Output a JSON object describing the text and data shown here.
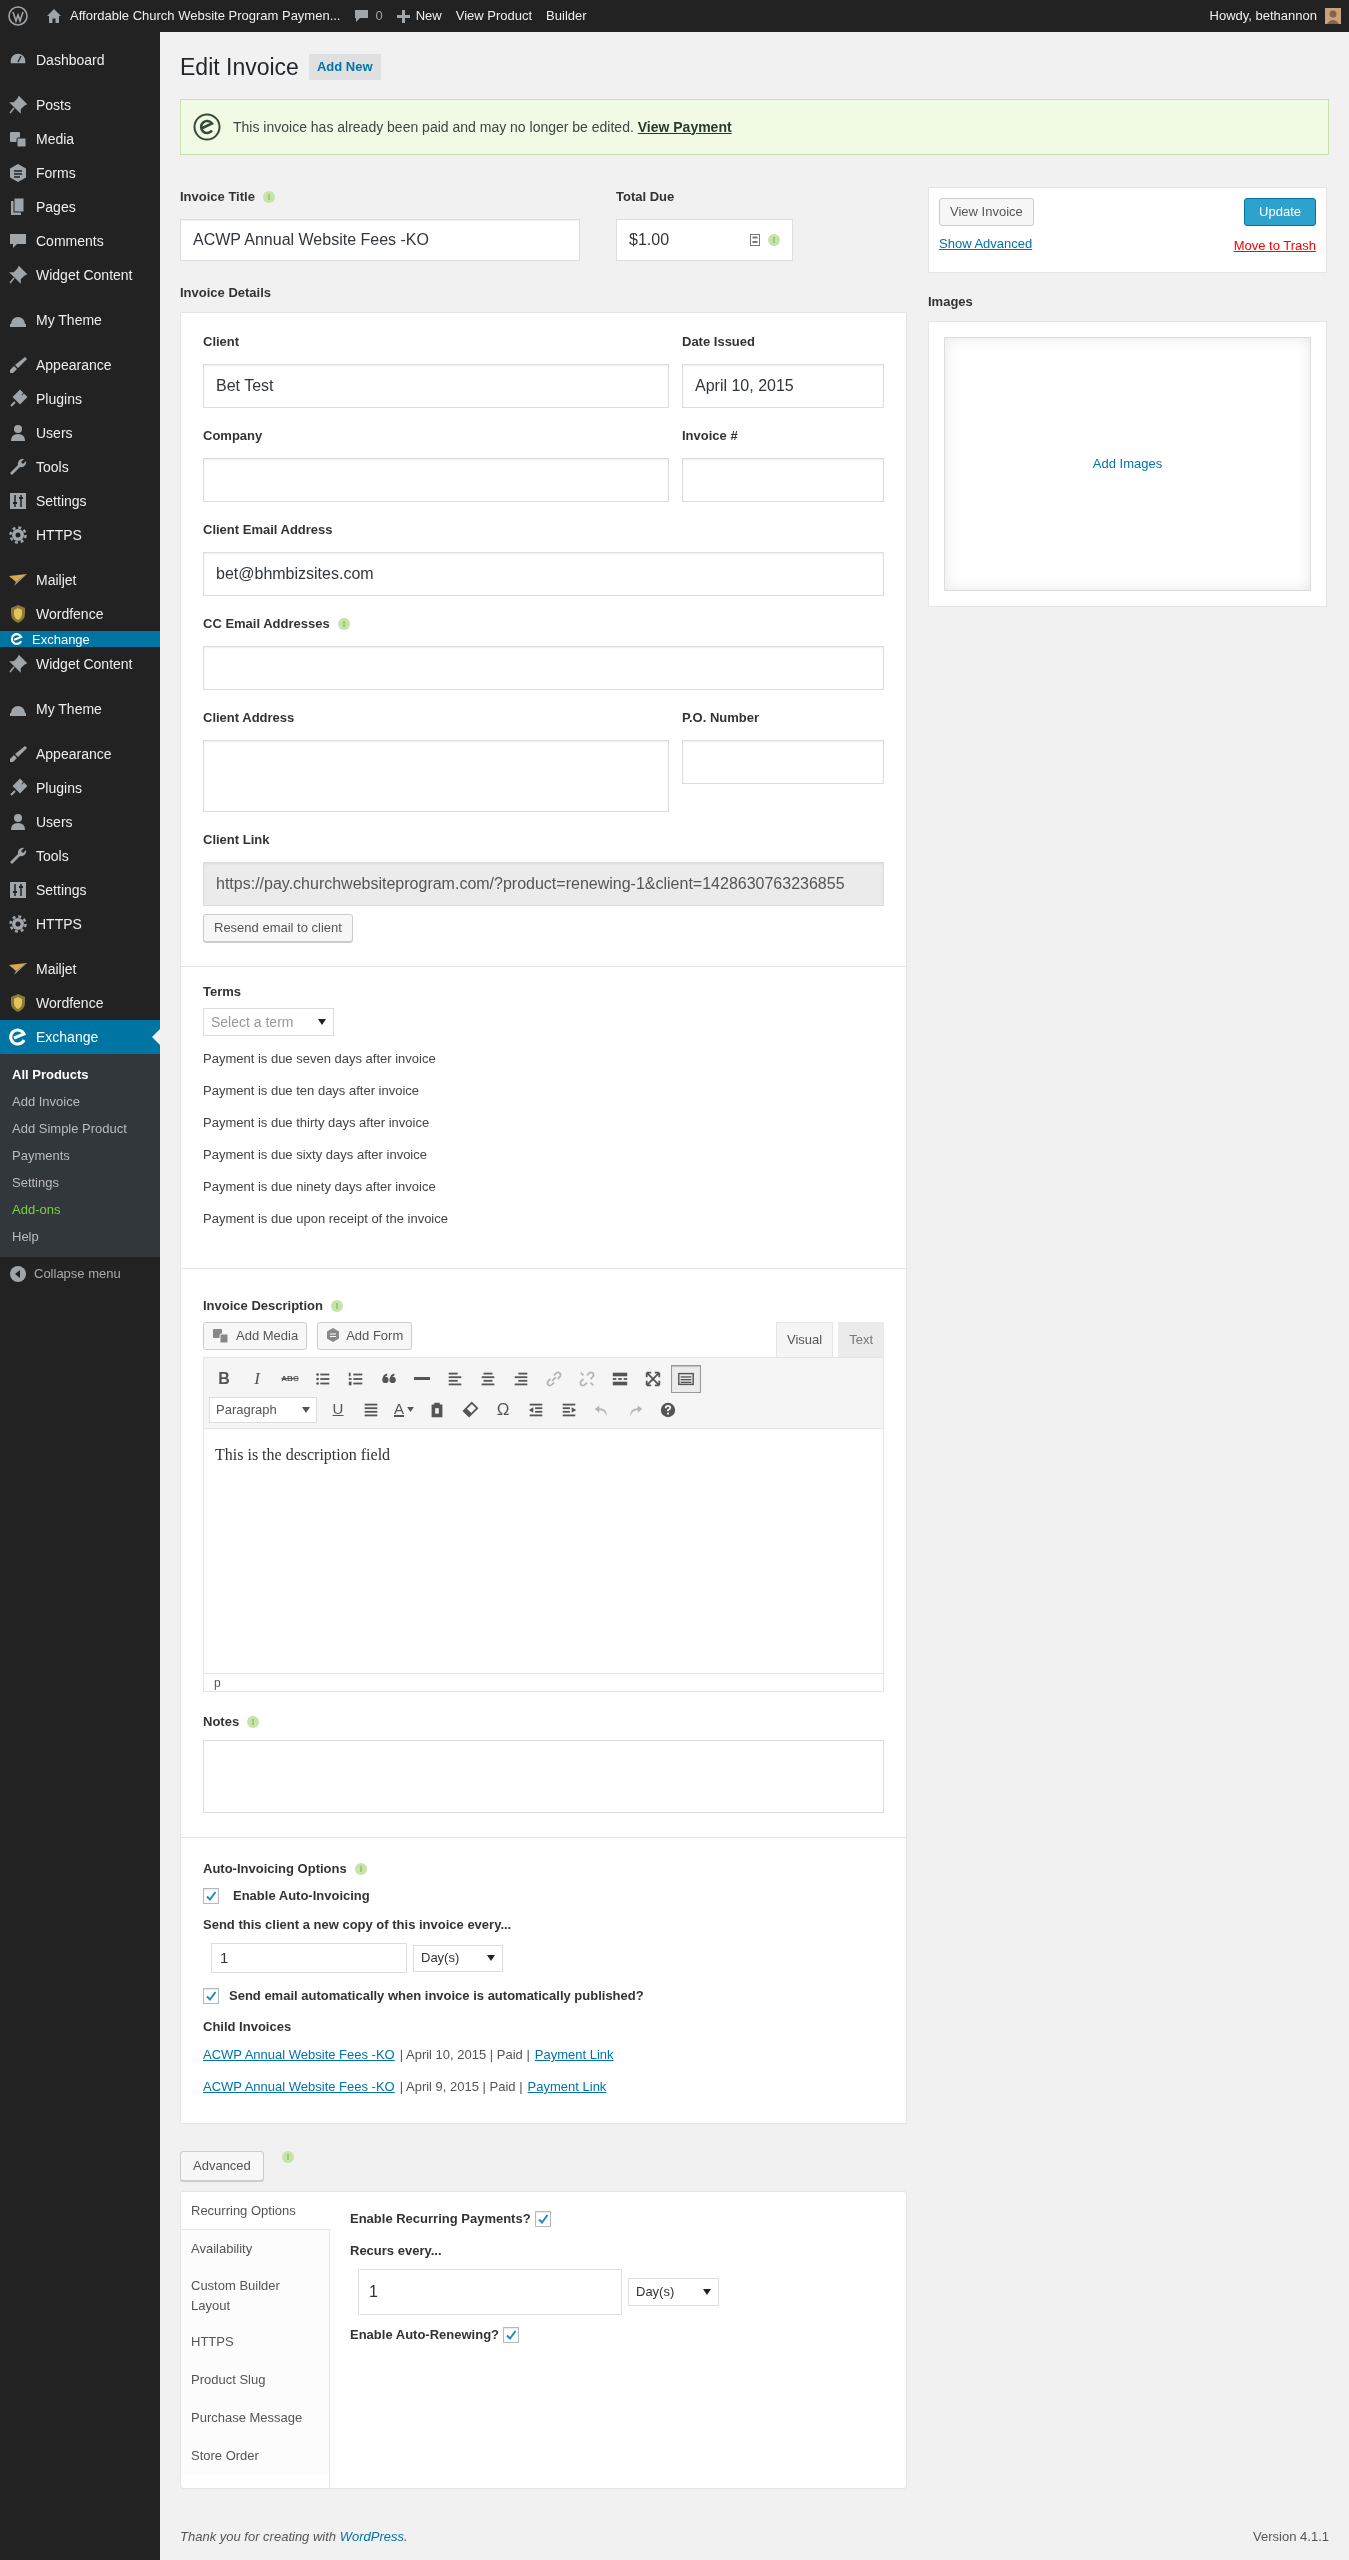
{
  "admin_bar": {
    "site_name": "Affordable Church Website Program Paymen...",
    "comments": "0",
    "new": "New",
    "links": [
      "View Product",
      "Builder"
    ],
    "greeting": "Howdy, bethannon"
  },
  "sidebar": {
    "menu_top": [
      [
        {
          "label": "Dashboard",
          "current": false
        }
      ],
      [
        {
          "label": "Posts",
          "current": false
        },
        {
          "label": "Media",
          "current": false
        },
        {
          "label": "Forms",
          "current": false
        },
        {
          "label": "Pages",
          "current": false
        },
        {
          "label": "Comments",
          "current": false
        },
        {
          "label": "Widget Content",
          "current": false
        }
      ],
      [
        {
          "label": "My Theme",
          "current": false
        }
      ],
      [
        {
          "label": "Appearance",
          "current": false
        },
        {
          "label": "Plugins",
          "current": false
        },
        {
          "label": "Users",
          "current": false
        },
        {
          "label": "Tools",
          "current": false
        },
        {
          "label": "Settings",
          "current": false
        },
        {
          "label": "HTTPS",
          "current": false
        }
      ],
      [
        {
          "label": "Mailjet",
          "current": false
        },
        {
          "label": "Wordfence",
          "current": false
        }
      ]
    ],
    "clipped_item": {
      "label": "Exchange",
      "current": true
    },
    "menu": [
      [
        {
          "label": "Widget Content",
          "current": false
        }
      ],
      [
        {
          "label": "My Theme",
          "current": false
        }
      ],
      [
        {
          "label": "Appearance",
          "current": false
        },
        {
          "label": "Plugins",
          "current": false
        },
        {
          "label": "Users",
          "current": false
        },
        {
          "label": "Tools",
          "current": false
        },
        {
          "label": "Settings",
          "current": false
        },
        {
          "label": "HTTPS",
          "current": false
        }
      ],
      [
        {
          "label": "Mailjet",
          "current": false
        },
        {
          "label": "Wordfence",
          "current": false
        },
        {
          "label": "Exchange",
          "current": true
        }
      ]
    ],
    "submenu": [
      {
        "label": "All Products",
        "selected": true,
        "kind": "link"
      },
      {
        "label": "Add Invoice",
        "selected": false,
        "kind": "link"
      },
      {
        "label": "Add Simple Product",
        "selected": false,
        "kind": "link"
      },
      {
        "label": "Payments",
        "selected": false,
        "kind": "link"
      },
      {
        "label": "Settings",
        "selected": false,
        "kind": "link"
      },
      {
        "label": "Add-ons",
        "selected": false,
        "kind": "accent"
      },
      {
        "label": "Help",
        "selected": false,
        "kind": "link"
      }
    ],
    "collapse": "Collapse menu"
  },
  "page": {
    "title": "Edit Invoice",
    "add_new": "Add New"
  },
  "notice": {
    "text": "This invoice has already been paid and may no longer be edited.",
    "link": "View Payment"
  },
  "invoice_title": {
    "label": "Invoice Title",
    "info": true,
    "value": "ACWP Annual Website Fees -KO"
  },
  "total_due": {
    "label": "Total Due",
    "info": true,
    "value": "$1.00"
  },
  "details": {
    "heading": "Invoice Details",
    "rows": [
      [
        {
          "label": "Client",
          "info": false,
          "kind": "input",
          "value": "Bet Test"
        },
        {
          "label": "Date Issued",
          "info": false,
          "kind": "input",
          "value": "April 10, 2015"
        }
      ],
      [
        {
          "label": "Company",
          "info": false,
          "kind": "input"
        },
        {
          "label": "Invoice #",
          "info": false,
          "kind": "input"
        }
      ],
      [
        {
          "label": "Client Email Address",
          "info": false,
          "kind": "input",
          "value": "bet@bhmbizsites.com"
        }
      ],
      [
        {
          "label": "CC Email Addresses",
          "info": true,
          "kind": "input"
        }
      ],
      [
        {
          "label": "Client Address",
          "info": false,
          "kind": "textarea"
        },
        {
          "label": "P.O. Number",
          "info": false,
          "kind": "input"
        }
      ],
      [
        {
          "label": "Client Link",
          "info": false,
          "kind": "readonly",
          "value": "https://pay.churchwebsiteprogram.com/?product=renewing-1&client=1428630763236855"
        }
      ]
    ],
    "resend": "Resend email to client"
  },
  "terms": {
    "label": "Terms",
    "select": "Select a term",
    "lines": [
      "Payment is due seven days after invoice",
      "Payment is due ten days after invoice",
      "Payment is due thirty days after invoice",
      "Payment is due sixty days after invoice",
      "Payment is due ninety days after invoice",
      "Payment is due upon receipt of the invoice"
    ]
  },
  "description": {
    "label": "Invoice Description",
    "info": true,
    "buttons": [
      "Add Media",
      "Add Form"
    ],
    "tabs": [
      {
        "label": "Visual",
        "selected": true
      },
      {
        "label": "Text",
        "selected": false
      }
    ],
    "toolbar": [
      [
        {
          "kind": "bold",
          "text": "B",
          "pressed": false,
          "disabled": false
        },
        {
          "kind": "italic",
          "text": "I",
          "pressed": false,
          "disabled": false
        },
        {
          "kind": "strike",
          "text": "ABC",
          "pressed": false,
          "disabled": false
        },
        {
          "kind": "icon",
          "pressed": false,
          "disabled": false
        },
        {
          "kind": "icon",
          "pressed": false,
          "disabled": false
        },
        {
          "kind": "icon",
          "pressed": false,
          "disabled": false
        },
        {
          "kind": "icon",
          "pressed": false,
          "disabled": false
        },
        {
          "kind": "icon",
          "pressed": false,
          "disabled": false
        },
        {
          "kind": "icon",
          "pressed": false,
          "disabled": false
        },
        {
          "kind": "icon",
          "pressed": false,
          "disabled": false
        },
        {
          "kind": "icon",
          "pressed": false,
          "disabled": true
        },
        {
          "kind": "icon",
          "pressed": false,
          "disabled": true
        },
        {
          "kind": "icon",
          "pressed": false,
          "disabled": false
        },
        {
          "kind": "icon",
          "pressed": false,
          "disabled": false
        },
        {
          "kind": "icon",
          "pressed": true,
          "disabled": false
        }
      ],
      [
        {
          "kind": "select",
          "text": "Paragraph",
          "pressed": false,
          "disabled": false
        },
        {
          "kind": "underline",
          "text": "U",
          "pressed": false,
          "disabled": false
        },
        {
          "kind": "icon",
          "pressed": false,
          "disabled": false
        },
        {
          "kind": "color",
          "text": "A",
          "pressed": false,
          "disabled": false
        },
        {
          "kind": "icon",
          "pressed": false,
          "disabled": false
        },
        {
          "kind": "icon",
          "pressed": false,
          "disabled": false
        },
        {
          "kind": "symbol",
          "text": "Ω",
          "pressed": false,
          "disabled": false
        },
        {
          "kind": "icon",
          "pressed": false,
          "disabled": false
        },
        {
          "kind": "icon",
          "pressed": false,
          "disabled": false
        },
        {
          "kind": "icon",
          "pressed": false,
          "disabled": true
        },
        {
          "kind": "icon",
          "pressed": false,
          "disabled": true
        },
        {
          "kind": "icon",
          "pressed": false,
          "disabled": false
        }
      ]
    ],
    "content": "This is the description field",
    "path": "p"
  },
  "notes": {
    "label": "Notes",
    "info": true
  },
  "auto_invoicing": {
    "label": "Auto-Invoicing Options",
    "info": true,
    "enable": {
      "label": "Enable Auto-Invoicing",
      "checked": true
    },
    "interval_label": "Send this client a new copy of this invoice every...",
    "interval_value": "1",
    "interval_unit": "Day(s)",
    "send_email": {
      "label": "Send email automatically when invoice is automatically published?",
      "checked": true
    },
    "child_heading": "Child Invoices",
    "children": [
      {
        "title": "ACWP Annual Website Fees -KO",
        "info": "| April 10, 2015 | Paid |",
        "link": "Payment Link"
      },
      {
        "title": "ACWP Annual Website Fees -KO",
        "info": "| April 9, 2015 | Paid |",
        "link": "Payment Link"
      }
    ]
  },
  "advanced": {
    "button": "Advanced",
    "info": true,
    "tabs": [
      {
        "label": "Recurring Options",
        "selected": true
      },
      {
        "label": "Availability",
        "selected": false
      },
      {
        "label": "Custom Builder Layout",
        "selected": false
      },
      {
        "label": "HTTPS",
        "selected": false
      },
      {
        "label": "Product Slug",
        "selected": false
      },
      {
        "label": "Purchase Message",
        "selected": false
      },
      {
        "label": "Store Order",
        "selected": false
      }
    ],
    "recurring": {
      "enable_label": "Enable Recurring Payments?",
      "enable_checked": true,
      "recurs_label": "Recurs every...",
      "value": "1",
      "unit": "Day(s)",
      "renew_label": "Enable Auto-Renewing?",
      "renew_checked": true
    }
  },
  "publish": {
    "view": "View Invoice",
    "update": "Update",
    "show_advanced": "Show Advanced",
    "trash": "Move to Trash"
  },
  "images": {
    "label": "Images",
    "add": "Add Images"
  },
  "footer": {
    "thanks": "Thank you for creating with",
    "link": "WordPress",
    "after": ".",
    "version": "Version 4.1.1"
  }
}
